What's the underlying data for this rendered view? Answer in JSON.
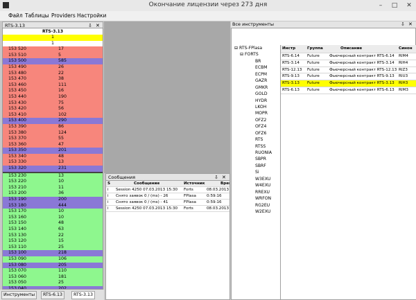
{
  "window": {
    "title": "Окончание лицензии через 273 дня",
    "minimize": "–",
    "maximize": "□",
    "close": "✕"
  },
  "menu": [
    "Файл",
    "Таблицы",
    "Providers",
    "Настройки"
  ],
  "orderbook": {
    "panel_title": "RTS-3.13",
    "pin": "⇩",
    "close": "✕",
    "instrument": "RTS-3.13",
    "top_values": [
      "1",
      "1"
    ],
    "rows": [
      {
        "p": "153 520",
        "v": "17",
        "t": "sell"
      },
      {
        "p": "153 510",
        "v": "5",
        "t": "sell"
      },
      {
        "p": "153 500",
        "v": "585",
        "t": "big"
      },
      {
        "p": "153 490",
        "v": "26",
        "t": "sell"
      },
      {
        "p": "153 480",
        "v": "22",
        "t": "sell"
      },
      {
        "p": "153 470",
        "v": "38",
        "t": "sell"
      },
      {
        "p": "153 460",
        "v": "111",
        "t": "sell"
      },
      {
        "p": "153 450",
        "v": "16",
        "t": "sell"
      },
      {
        "p": "153 440",
        "v": "190",
        "t": "sell"
      },
      {
        "p": "153 430",
        "v": "75",
        "t": "sell"
      },
      {
        "p": "153 420",
        "v": "56",
        "t": "sell"
      },
      {
        "p": "153 410",
        "v": "102",
        "t": "sell"
      },
      {
        "p": "153 400",
        "v": "290",
        "t": "big"
      },
      {
        "p": "153 390",
        "v": "86",
        "t": "sell"
      },
      {
        "p": "153 380",
        "v": "124",
        "t": "sell"
      },
      {
        "p": "153 370",
        "v": "55",
        "t": "sell"
      },
      {
        "p": "153 360",
        "v": "47",
        "t": "sell"
      },
      {
        "p": "153 350",
        "v": "201",
        "t": "big"
      },
      {
        "p": "153 340",
        "v": "48",
        "t": "sell"
      },
      {
        "p": "153 330",
        "v": "13",
        "t": "sell"
      },
      {
        "p": "153 320",
        "v": "231",
        "t": "big"
      },
      {
        "p": "153 230",
        "v": "13",
        "t": "buy"
      },
      {
        "p": "153 220",
        "v": "10",
        "t": "buy"
      },
      {
        "p": "153 210",
        "v": "11",
        "t": "buy"
      },
      {
        "p": "153 200",
        "v": "36",
        "t": "buy"
      },
      {
        "p": "153 190",
        "v": "200",
        "t": "big"
      },
      {
        "p": "153 180",
        "v": "444",
        "t": "big"
      },
      {
        "p": "153 170",
        "v": "10",
        "t": "buy"
      },
      {
        "p": "153 160",
        "v": "10",
        "t": "buy"
      },
      {
        "p": "153 150",
        "v": "48",
        "t": "buy"
      },
      {
        "p": "153 140",
        "v": "63",
        "t": "buy"
      },
      {
        "p": "153 130",
        "v": "22",
        "t": "buy"
      },
      {
        "p": "153 120",
        "v": "15",
        "t": "buy"
      },
      {
        "p": "153 110",
        "v": "25",
        "t": "buy"
      },
      {
        "p": "153 100",
        "v": "218",
        "t": "big"
      },
      {
        "p": "153 090",
        "v": "106",
        "t": "buy"
      },
      {
        "p": "153 080",
        "v": "205",
        "t": "big"
      },
      {
        "p": "153 070",
        "v": "110",
        "t": "buy"
      },
      {
        "p": "153 060",
        "v": "181",
        "t": "buy"
      },
      {
        "p": "153 050",
        "v": "25",
        "t": "buy"
      },
      {
        "p": "153 040",
        "v": "202",
        "t": "big"
      },
      {
        "p": "153 030",
        "v": "62",
        "t": "buy"
      }
    ]
  },
  "bottom_tabs": [
    "Инструменты",
    "RTS-6.13",
    "RTS-3.13"
  ],
  "messages": {
    "panel_title": "Сообщения",
    "pin": "⇩",
    "close": "✕",
    "columns": [
      "S",
      "Сообщение",
      "Источник",
      "Врем"
    ],
    "rows": [
      {
        "s": "i",
        "msg": "Session 4250 07.03.2013 15:30",
        "src": "Forts",
        "time": "08.03.2013"
      },
      {
        "s": "i",
        "msg": "Снято заявок 0 / (ms) - 26",
        "src": "FPlasa",
        "time": "0:59:16"
      },
      {
        "s": "i",
        "msg": "Снято заявок 0 / (ms) - 41",
        "src": "FPlasa",
        "time": "0:59:16"
      },
      {
        "s": "i",
        "msg": "Session 4250 07.03.2013 15:30",
        "src": "Forts",
        "time": "08.03.2013"
      }
    ]
  },
  "instruments": {
    "panel_title": "Все инструменты",
    "pin": "⇩",
    "close": "✕",
    "tree_root": "RTS-FPlasa",
    "tree_group": "FORTS",
    "tree_items": [
      "BR",
      "ECBM",
      "ECPM",
      "GAZR",
      "GMKR",
      "GOLD",
      "HYDR",
      "LKOH",
      "MOPR",
      "OFZ2",
      "OFZ4",
      "OFZ6",
      "RTS",
      "RTSS",
      "RUONIA",
      "SBPR",
      "SBRF",
      "Si",
      "W3EXU",
      "W4EXU",
      "RREXU",
      "WRFON",
      "RG2EU",
      "W2EXU"
    ],
    "columns": [
      "Инстр",
      "Группа",
      "Описание",
      "Синон"
    ],
    "rows": [
      {
        "instr": "RTS-6.14",
        "group": "Future",
        "desc": "Фьючерсный контракт RTS-6.14",
        "syn": "RIM4",
        "sel": false
      },
      {
        "instr": "RTS-3.14",
        "group": "Future",
        "desc": "Фьючерсный контракт RTS-3.14",
        "syn": "RIH4",
        "sel": false
      },
      {
        "instr": "RTS-12.13",
        "group": "Future",
        "desc": "Фьючерсный контракт RTS-12.13",
        "syn": "RIZ3",
        "sel": false
      },
      {
        "instr": "RTS-9.13",
        "group": "Future",
        "desc": "Фьючерсный контракт RTS-9.13",
        "syn": "RIU3",
        "sel": false
      },
      {
        "instr": "RTS-3.13",
        "group": "Future",
        "desc": "Фьючерсный контракт RTS-3.13",
        "syn": "RIH3",
        "sel": true
      },
      {
        "instr": "RTS-6.13",
        "group": "Future",
        "desc": "Фьючерсный контракт RTS-6.13",
        "syn": "RIM3",
        "sel": false
      }
    ]
  }
}
